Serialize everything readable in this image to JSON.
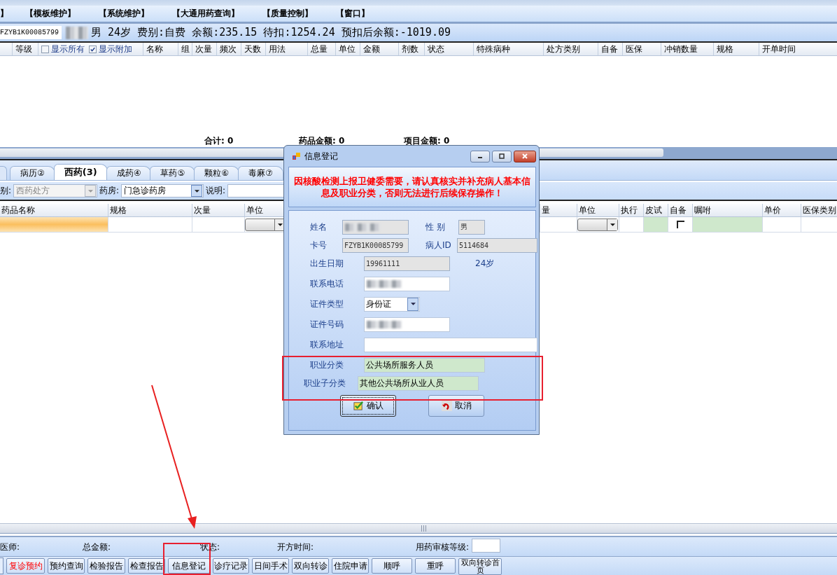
{
  "menu": [
    "】",
    "【模板维护】",
    "【系统维护】",
    "【大通用药查询】",
    "【质量控制】",
    "【窗口】"
  ],
  "patient": {
    "card": "FZYB1K00085799",
    "summary": "男 24岁 费别:自费 余额:235.15 待扣:1254.24 预扣后余额:-1019.09"
  },
  "order_grid": {
    "columns": [
      "",
      "等级",
      "",
      "名称",
      "组",
      "次量",
      "频次",
      "天数",
      "用法",
      "总量",
      "单位",
      "金额",
      "剂数",
      "状态",
      "特殊病种",
      "处方类别",
      "自备",
      "医保",
      "冲销数量",
      "规格",
      "开单时间"
    ],
    "checkboxes": [
      {
        "label": "显示所有",
        "checked": false
      },
      {
        "label": "显示附加",
        "checked": true
      }
    ],
    "totals": [
      "合计:  0",
      "药品金额:  0",
      "项目金额:  0"
    ]
  },
  "tabs": [
    {
      "label": "病历②",
      "selected": false
    },
    {
      "label": "西药(3)",
      "selected": true
    },
    {
      "label": "成药④",
      "selected": false
    },
    {
      "label": "草药⑤",
      "selected": false
    },
    {
      "label": "颗粒⑥",
      "selected": false
    },
    {
      "label": "毒麻⑦",
      "selected": false
    }
  ],
  "filters": {
    "type_label": "别:",
    "type_value": "西药处方",
    "type_disabled": true,
    "pharmacy_label": "药房:",
    "pharmacy_value": "门急诊药房",
    "note_label": "说明:"
  },
  "drug_grid": {
    "columns": [
      "药品名称",
      "规格",
      "次量",
      "单位",
      "",
      "量",
      "单位",
      "执行",
      "皮试",
      "自备",
      "嘱咐",
      "单价",
      "医保类别"
    ],
    "row": [
      {
        "kind": "selected"
      },
      {
        "kind": "blank"
      },
      {
        "kind": "blank"
      },
      {
        "kind": "dropdown"
      },
      {
        "kind": "blank"
      },
      {
        "kind": "blank"
      },
      {
        "kind": "dropdown"
      },
      {
        "kind": "blank"
      },
      {
        "kind": "green"
      },
      {
        "kind": "checkbox",
        "checked": false
      },
      {
        "kind": "green"
      },
      {
        "kind": "blank"
      },
      {
        "kind": "blank"
      }
    ]
  },
  "status_bar": {
    "labels": [
      "医师:",
      "总金额:",
      "状态:",
      "开方时间:",
      "用药审核等级:"
    ]
  },
  "buttons": [
    {
      "label": "复诊预约",
      "kind": "alert"
    },
    {
      "label": "预约查询",
      "kind": "normal"
    },
    {
      "label": "检验报告",
      "kind": "normal"
    },
    {
      "label": "检查报告",
      "kind": "normal"
    },
    {
      "label": "信息登记",
      "kind": "normal"
    },
    {
      "label": "诊疗记录",
      "kind": "normal"
    },
    {
      "label": "日间手术",
      "kind": "normal"
    },
    {
      "label": "双向转诊",
      "kind": "normal"
    },
    {
      "label": "住院申请",
      "kind": "normal"
    },
    {
      "label": "顺呼",
      "kind": "normal"
    },
    {
      "label": "重呼",
      "kind": "normal"
    },
    {
      "label": "双向转诊首页",
      "kind": "normal"
    }
  ],
  "dialog": {
    "title": "信息登记",
    "message": "因核酸检测上报卫健委需要，请认真核实并补充病人基本信息及职业分类，否则无法进行后续保存操作！",
    "rows": [
      {
        "fields": [
          {
            "label": "姓名",
            "kind": "text",
            "redacted": true,
            "readonly": true
          },
          {
            "label": "性 别",
            "kind": "text",
            "value": "男",
            "readonly": true
          }
        ]
      },
      {
        "fields": [
          {
            "label": "卡号",
            "kind": "text",
            "value": "FZYB1K00085799",
            "readonly": true
          },
          {
            "label": "病人ID",
            "kind": "text",
            "value": "5114684",
            "readonly": true
          }
        ]
      },
      {
        "fields": [
          {
            "label": "出生日期",
            "kind": "text",
            "value": "19961111",
            "readonly": true
          },
          {
            "kind": "note",
            "value": "24岁"
          }
        ]
      },
      {
        "fields": [
          {
            "label": "联系电话",
            "kind": "text",
            "redacted": true,
            "readonly": false
          }
        ]
      },
      {
        "fields": [
          {
            "label": "证件类型",
            "kind": "dropdown",
            "value": "身份证",
            "readonly": false
          }
        ]
      },
      {
        "fields": [
          {
            "label": "证件号码",
            "kind": "text",
            "redacted": true,
            "readonly": false
          }
        ]
      },
      {
        "fields": [
          {
            "label": "联系地址",
            "kind": "text",
            "readonly": false
          }
        ]
      },
      {
        "fields": [
          {
            "label": "职业分类",
            "kind": "text",
            "value": "公共场所服务人员",
            "readonly": false,
            "highlighted": true
          }
        ]
      },
      {
        "fields": [
          {
            "label": "职业子分类",
            "kind": "text",
            "value": "其他公共场所从业人员",
            "readonly": false,
            "highlighted": true
          }
        ]
      }
    ],
    "buttons": [
      {
        "label": "确认",
        "kind": "ok",
        "focused": true
      },
      {
        "label": "取消",
        "kind": "cancel",
        "focused": false
      }
    ]
  }
}
